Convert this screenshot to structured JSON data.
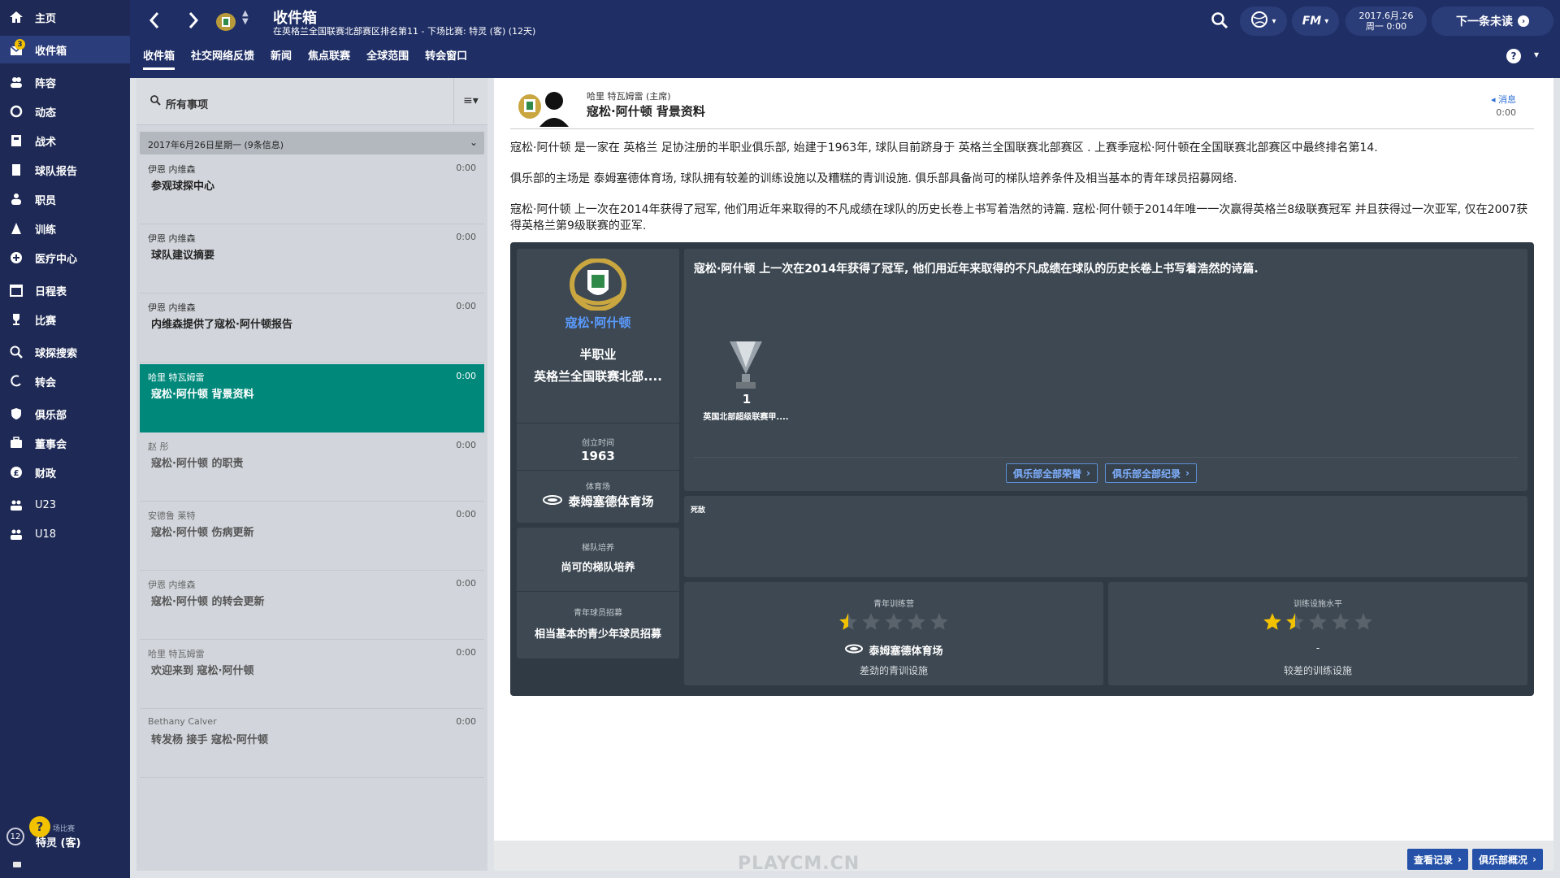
{
  "sidebar": {
    "items": [
      {
        "label": "主页",
        "icon": "home-icon"
      },
      {
        "label": "收件箱",
        "icon": "inbox-icon",
        "badge": "3"
      },
      {
        "label": "阵容",
        "icon": "squad-icon"
      },
      {
        "label": "动态",
        "icon": "dynamics-icon"
      },
      {
        "label": "战术",
        "icon": "tactics-icon"
      },
      {
        "label": "球队报告",
        "icon": "report-icon"
      },
      {
        "label": "职员",
        "icon": "staff-icon"
      },
      {
        "label": "训练",
        "icon": "training-icon"
      },
      {
        "label": "医疗中心",
        "icon": "medical-icon"
      },
      {
        "label": "日程表",
        "icon": "calendar-icon"
      },
      {
        "label": "比赛",
        "icon": "trophy-icon"
      },
      {
        "label": "球探搜索",
        "icon": "search-icon"
      },
      {
        "label": "转会",
        "icon": "transfer-icon"
      },
      {
        "label": "俱乐部",
        "icon": "club-icon"
      },
      {
        "label": "董事会",
        "icon": "board-icon"
      },
      {
        "label": "财政",
        "icon": "finance-icon"
      },
      {
        "label": "U23",
        "icon": "u23-icon"
      },
      {
        "label": "U18",
        "icon": "u18-icon"
      }
    ],
    "next_match_small": "场比赛",
    "next_match": "特灵 (客)",
    "round": "12",
    "help": "?"
  },
  "header": {
    "title": "收件箱",
    "subtitle": "在英格兰全国联赛北部赛区排名第11 - 下场比赛: 特灵 (客) (12天)",
    "tabs": [
      "收件箱",
      "社交网络反馈",
      "新闻",
      "焦点联赛",
      "全球范围",
      "转会窗口"
    ],
    "active_tab": 0,
    "date_line1": "2017.6月.26",
    "date_line2": "周一 0:00",
    "next_button": "下一条未读",
    "fm_label": "FM",
    "help": "?"
  },
  "inbox": {
    "search_label": "所有事项",
    "group_label": "2017年6月26日星期一 (9条信息)",
    "messages": [
      {
        "sender": "伊恩 内维森",
        "time": "0:00",
        "subject": "参观球探中心",
        "state": "unread"
      },
      {
        "sender": "伊恩 内维森",
        "time": "0:00",
        "subject": "球队建议摘要",
        "state": "unread"
      },
      {
        "sender": "伊恩 内维森",
        "time": "0:00",
        "subject": "内维森提供了寇松·阿什顿报告",
        "state": "unread"
      },
      {
        "sender": "哈里 特瓦姆雷",
        "time": "0:00",
        "subject": "寇松·阿什顿 背景资料",
        "state": "selected"
      },
      {
        "sender": "赵 彤",
        "time": "0:00",
        "subject": "寇松·阿什顿 的职责",
        "state": "read"
      },
      {
        "sender": "安德鲁 莱特",
        "time": "0:00",
        "subject": "寇松·阿什顿 伤病更新",
        "state": "read"
      },
      {
        "sender": "伊恩 内维森",
        "time": "0:00",
        "subject": "寇松·阿什顿 的转会更新",
        "state": "read"
      },
      {
        "sender": "哈里 特瓦姆雷",
        "time": "0:00",
        "subject": "欢迎来到 寇松·阿什顿",
        "state": "read"
      },
      {
        "sender": "Bethany Calver",
        "time": "0:00",
        "subject": "转发杨 接手 寇松·阿什顿",
        "state": "read"
      }
    ]
  },
  "detail": {
    "from": "哈里 特瓦姆雷 (主席)",
    "subject": "寇松·阿什顿 背景资料",
    "tag": "消息",
    "time": "0:00",
    "para1": "寇松·阿什顿 是一家在 英格兰 足协注册的半职业俱乐部, 始建于1963年, 球队目前跻身于 英格兰全国联赛北部赛区 . 上赛季寇松·阿什顿在全国联赛北部赛区中最终排名第14.",
    "para2": "俱乐部的主场是 泰姆塞德体育场, 球队拥有较差的训练设施以及糟糕的青训设施. 俱乐部具备尚可的梯队培养条件及相当基本的青年球员招募网络.",
    "para3": "寇松·阿什顿 上一次在2014年获得了冠军, 他们用近年来取得的不凡成绩在球队的历史长卷上书写着浩然的诗篇. 寇松·阿什顿于2014年唯一一次赢得英格兰8级联赛冠军 并且获得过一次亚军, 仅在2007获得英格兰第9级联赛的亚军.",
    "club_card": {
      "name": "寇松·阿什顿",
      "status": "半职业",
      "league": "英格兰全国联赛北部....",
      "founded_label": "创立时间",
      "founded": "1963",
      "stadium_label": "体育场",
      "stadium": "泰姆塞德体育场",
      "youth_label": "梯队培养",
      "youth": "尚可的梯队培养",
      "recruit_label": "青年球员招募",
      "recruit": "相当基本的青少年球员招募"
    },
    "honours": {
      "text": "寇松·阿什顿 上一次在2014年获得了冠军, 他们用近年来取得的不凡成绩在球队的历史长卷上书写着浩然的诗篇.",
      "trophy_count": "1",
      "trophy_name": "英国北部超级联赛甲....",
      "btn_honours": "俱乐部全部荣誉",
      "btn_records": "俱乐部全部纪录"
    },
    "rivals_label": "死敌",
    "youth_facilities": {
      "label": "青年训练营",
      "stars": 0.5,
      "venue": "泰姆塞德体育场",
      "desc": "差劲的青训设施"
    },
    "training_facilities": {
      "label": "训练设施水平",
      "stars": 1.5,
      "venue": "-",
      "desc": "较差的训练设施"
    },
    "footer_btn1": "查看记录",
    "footer_btn2": "俱乐部概况"
  },
  "watermark": "PLAYCM.CN",
  "colors": {
    "sidebar_bg": "#1e2a55",
    "header_bg": "#1f2f66",
    "selected_msg": "#00897b",
    "star_gold": "#f2c200",
    "link_blue": "#5b9bff"
  }
}
